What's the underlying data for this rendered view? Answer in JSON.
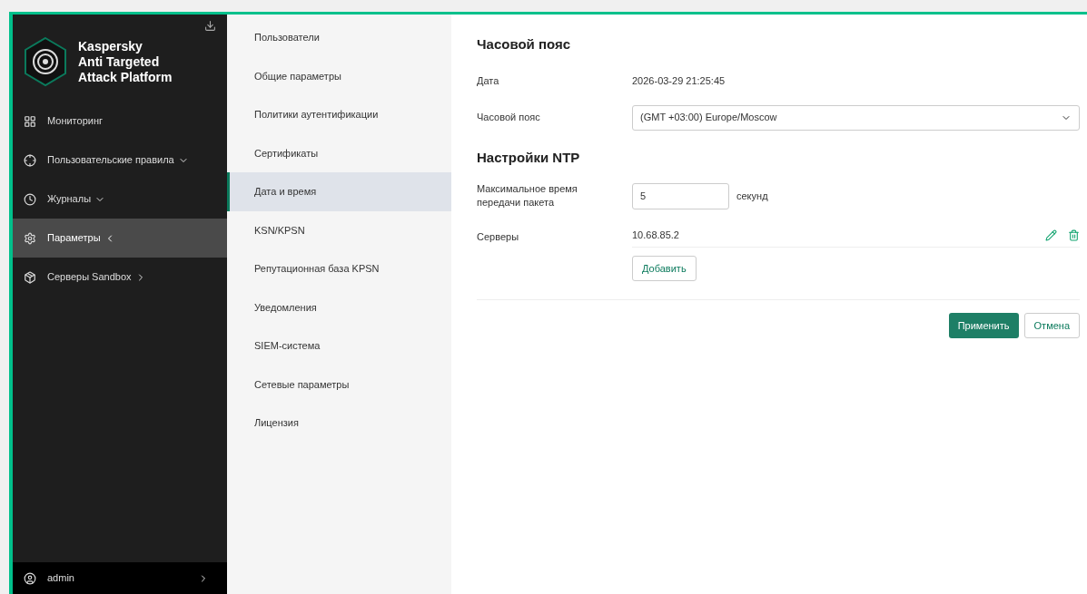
{
  "brand": {
    "title": "Kaspersky\nAnti Targeted\nAttack Platform"
  },
  "nav": [
    {
      "label": "Мониторинг",
      "selected": false
    },
    {
      "label": "Пользовательские правила",
      "selected": false
    },
    {
      "label": "Журналы",
      "selected": false
    },
    {
      "label": "Параметры",
      "selected": true
    },
    {
      "label": "Серверы Sandbox",
      "selected": false
    }
  ],
  "user": {
    "name": "admin"
  },
  "submenu": [
    {
      "label": "Пользователи",
      "selected": false
    },
    {
      "label": "Общие параметры",
      "selected": false
    },
    {
      "label": "Политики аутентификации",
      "selected": false
    },
    {
      "label": "Сертификаты",
      "selected": false
    },
    {
      "label": "Дата и время",
      "selected": true
    },
    {
      "label": "KSN/KPSN",
      "selected": false
    },
    {
      "label": "Репутационная база KPSN",
      "selected": false
    },
    {
      "label": "Уведомления",
      "selected": false
    },
    {
      "label": "SIEM-система",
      "selected": false
    },
    {
      "label": "Сетевые параметры",
      "selected": false
    },
    {
      "label": "Лицензия",
      "selected": false
    }
  ],
  "timezone_section": {
    "title": "Часовой пояс",
    "date_label": "Дата",
    "date_value": "2026-03-29 21:25:45",
    "tz_label": "Часовой пояс",
    "tz_value": "(GMT +03:00) Europe/Moscow"
  },
  "ntp_section": {
    "title": "Настройки NTP",
    "timeout_label": "Максимальное время передачи пакета",
    "timeout_value": "5",
    "timeout_unit": "секунд",
    "servers_label": "Серверы",
    "servers": [
      "10.68.85.2"
    ],
    "add_button": "Добавить"
  },
  "buttons": {
    "apply": "Применить",
    "cancel": "Отмена"
  }
}
